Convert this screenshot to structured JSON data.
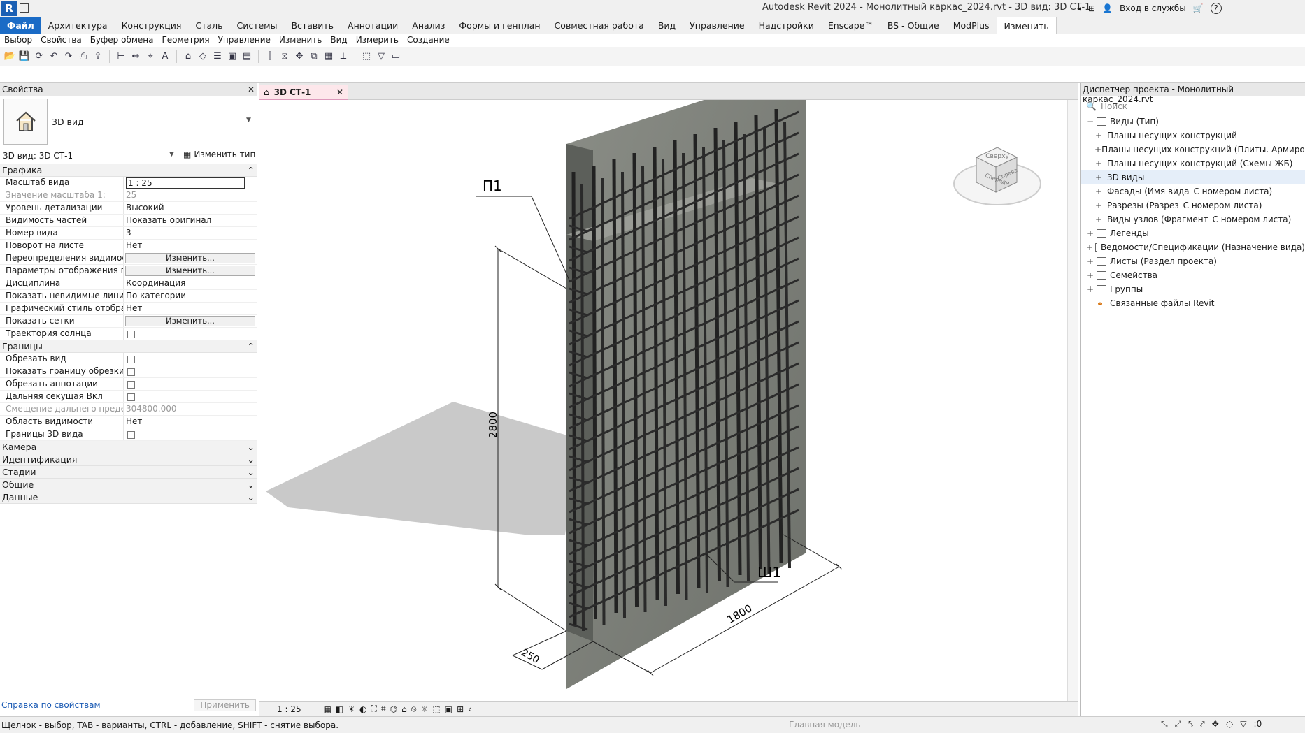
{
  "app": {
    "title": "Autodesk Revit 2024 - Монолитный каркас_2024.rvt - 3D вид: 3D СТ-1",
    "logo": "R",
    "signin": "Вход в службы",
    "help": "?"
  },
  "ribbon": {
    "tabs": [
      "Файл",
      "Архитектура",
      "Конструкция",
      "Сталь",
      "Системы",
      "Вставить",
      "Аннотации",
      "Анализ",
      "Формы и генплан",
      "Совместная работа",
      "Вид",
      "Управление",
      "Надстройки",
      "Enscape™",
      "BS - Общие",
      "ModPlus",
      "Изменить"
    ],
    "active_tab": "Изменить",
    "panels": [
      "Выбор",
      "Свойства",
      "Буфер обмена",
      "Геометрия",
      "Управление",
      "Изменить",
      "Вид",
      "Измерить",
      "Создание"
    ]
  },
  "properties": {
    "title": "Свойства",
    "type_name": "3D вид",
    "view_selector": "3D вид: 3D СТ-1",
    "edit_type": "Изменить тип",
    "sections": [
      {
        "name": "Графика",
        "rows": [
          {
            "k": "Масштаб вида",
            "v": "1 : 25",
            "kind": "input"
          },
          {
            "k": "Значение масштаба    1:",
            "v": "25",
            "kind": "dis"
          },
          {
            "k": "Уровень детализации",
            "v": "Высокий"
          },
          {
            "k": "Видимость частей",
            "v": "Показать оригинал"
          },
          {
            "k": "Номер вида",
            "v": "3"
          },
          {
            "k": "Поворот на листе",
            "v": "Нет"
          },
          {
            "k": "Переопределения видимост...",
            "v": "Изменить...",
            "kind": "btn"
          },
          {
            "k": "Параметры отображения гр...",
            "v": "Изменить...",
            "kind": "btn"
          },
          {
            "k": "Дисциплина",
            "v": "Координация"
          },
          {
            "k": "Показать невидимые линии",
            "v": "По категории"
          },
          {
            "k": "Графический стиль отобра...",
            "v": "Нет"
          },
          {
            "k": "Показать сетки",
            "v": "Изменить...",
            "kind": "btn"
          },
          {
            "k": "Траектория солнца",
            "v": "",
            "kind": "cb"
          }
        ]
      },
      {
        "name": "Границы",
        "rows": [
          {
            "k": "Обрезать вид",
            "v": "",
            "kind": "cb"
          },
          {
            "k": "Показать границу обрезки",
            "v": "",
            "kind": "cb"
          },
          {
            "k": "Обрезать аннотации",
            "v": "",
            "kind": "cb"
          },
          {
            "k": "Дальняя секущая Вкл",
            "v": "",
            "kind": "cb"
          },
          {
            "k": "Смещение дальнего предел...",
            "v": "304800.000",
            "kind": "dis"
          },
          {
            "k": "Область видимости",
            "v": "Нет"
          },
          {
            "k": "Границы 3D вида",
            "v": "",
            "kind": "cb"
          }
        ]
      }
    ],
    "collapsed": [
      "Камера",
      "Идентификация",
      "Стадии",
      "Общие",
      "Данные"
    ],
    "help_link": "Справка по свойствам",
    "apply": "Применить"
  },
  "view": {
    "tab": "3D СТ-1",
    "scale": "1 : 25",
    "labels": {
      "p1": "П1",
      "sh1": "Ш1",
      "height": "2800",
      "width": "1800",
      "thick": "250"
    },
    "cube": {
      "top": "Сверху",
      "left": "Спереди",
      "right": "Справа"
    }
  },
  "browser": {
    "title": "Диспетчер проекта - Монолитный каркас_2024.rvt",
    "search_placeholder": "Поиск",
    "tree": [
      {
        "label": "Виды (Тип)",
        "level": 0,
        "pm": "−",
        "icon": "views"
      },
      {
        "label": "Планы несущих конструкций",
        "level": 1,
        "pm": "+"
      },
      {
        "label": "Планы несущих конструкций (Плиты. Армирование",
        "level": 1,
        "pm": "+"
      },
      {
        "label": "Планы несущих конструкций (Схемы ЖБ)",
        "level": 1,
        "pm": "+"
      },
      {
        "label": "3D виды",
        "level": 1,
        "pm": "+",
        "sel": true
      },
      {
        "label": "Фасады (Имя вида_С номером листа)",
        "level": 1,
        "pm": "+"
      },
      {
        "label": "Разрезы (Разрез_С номером листа)",
        "level": 1,
        "pm": "+"
      },
      {
        "label": "Виды узлов (Фрагмент_С номером листа)",
        "level": 1,
        "pm": "+"
      },
      {
        "label": "Легенды",
        "level": 0,
        "pm": "+",
        "icon": "legend"
      },
      {
        "label": "Ведомости/Спецификации (Назначение вида)",
        "level": 0,
        "pm": "+",
        "icon": "sched"
      },
      {
        "label": "Листы (Раздел проекта)",
        "level": 0,
        "pm": "+",
        "icon": "sheet"
      },
      {
        "label": "Семейства",
        "level": 0,
        "pm": "+",
        "icon": "fam"
      },
      {
        "label": "Группы",
        "level": 0,
        "pm": "+",
        "icon": "grp"
      },
      {
        "label": "Связанные файлы Revit",
        "level": 0,
        "pm": "",
        "icon": "link"
      }
    ]
  },
  "status": {
    "text": "Щелчок - выбор, TAB - варианты, CTRL - добавление, SHIFT - снятие выбора.",
    "workset": "Главная модель",
    "coord": ":0",
    "filter": ":0"
  },
  "colors": {
    "accent": "#1a6bc6",
    "tab_highlight": "#fde7eb"
  }
}
